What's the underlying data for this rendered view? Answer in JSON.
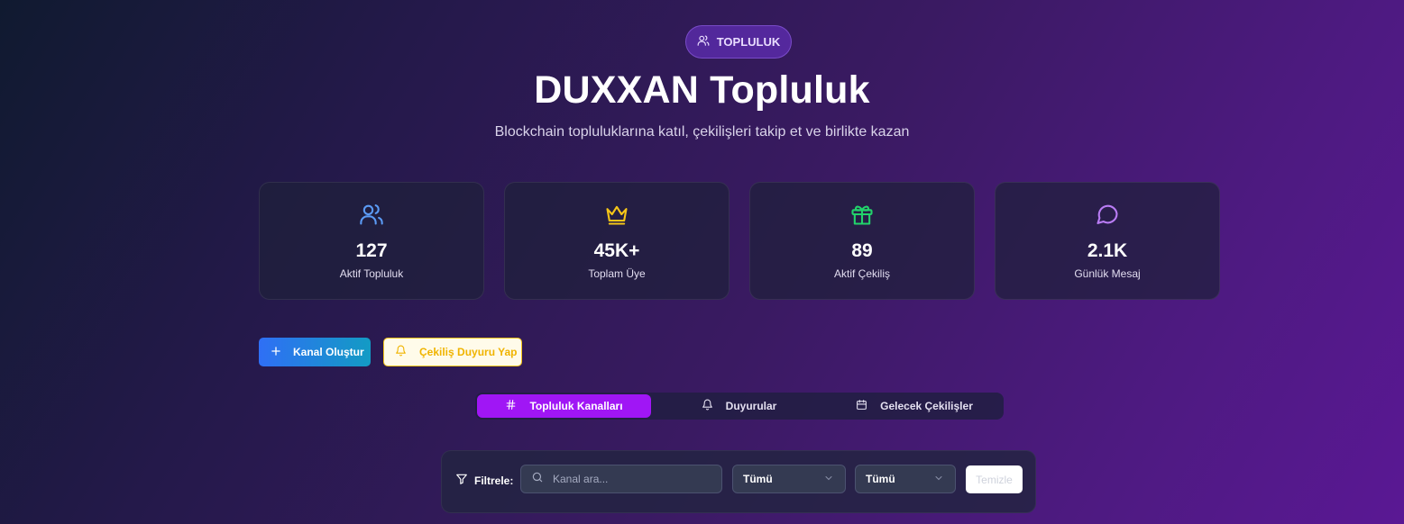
{
  "header": {
    "badge_label": "TOPLULUK",
    "title": "DUXXAN Topluluk",
    "subtitle": "Blockchain topluluklarına katıl, çekilişleri takip et ve birlikte kazan"
  },
  "stats": [
    {
      "icon": "users-icon",
      "color": "#5b9bf5",
      "value": "127",
      "label": "Aktif Topluluk"
    },
    {
      "icon": "crown-icon",
      "color": "#f5c518",
      "value": "45K+",
      "label": "Toplam Üye"
    },
    {
      "icon": "gift-icon",
      "color": "#22d36b",
      "value": "89",
      "label": "Aktif Çekiliş"
    },
    {
      "icon": "message-circle-icon",
      "color": "#b97cf5",
      "value": "2.1K",
      "label": "Günlük Mesaj"
    }
  ],
  "actions": {
    "create_channel": "Kanal Oluştur",
    "announce_giveaway": "Çekiliş Duyuru Yap"
  },
  "tabs": [
    {
      "icon": "hash-icon",
      "label": "Topluluk Kanalları",
      "active": true
    },
    {
      "icon": "bell-icon",
      "label": "Duyurular",
      "active": false
    },
    {
      "icon": "calendar-icon",
      "label": "Gelecek Çekilişler",
      "active": false
    }
  ],
  "filters": {
    "label": "Filtrele:",
    "search_placeholder": "Kanal ara...",
    "select_1_value": "Tümü",
    "select_2_value": "Tümü",
    "clear_label": "Temizle"
  },
  "colors": {
    "accent_purple": "#a016f5",
    "accent_blue": "#2f6ff5",
    "accent_yellow": "#f5c518"
  }
}
